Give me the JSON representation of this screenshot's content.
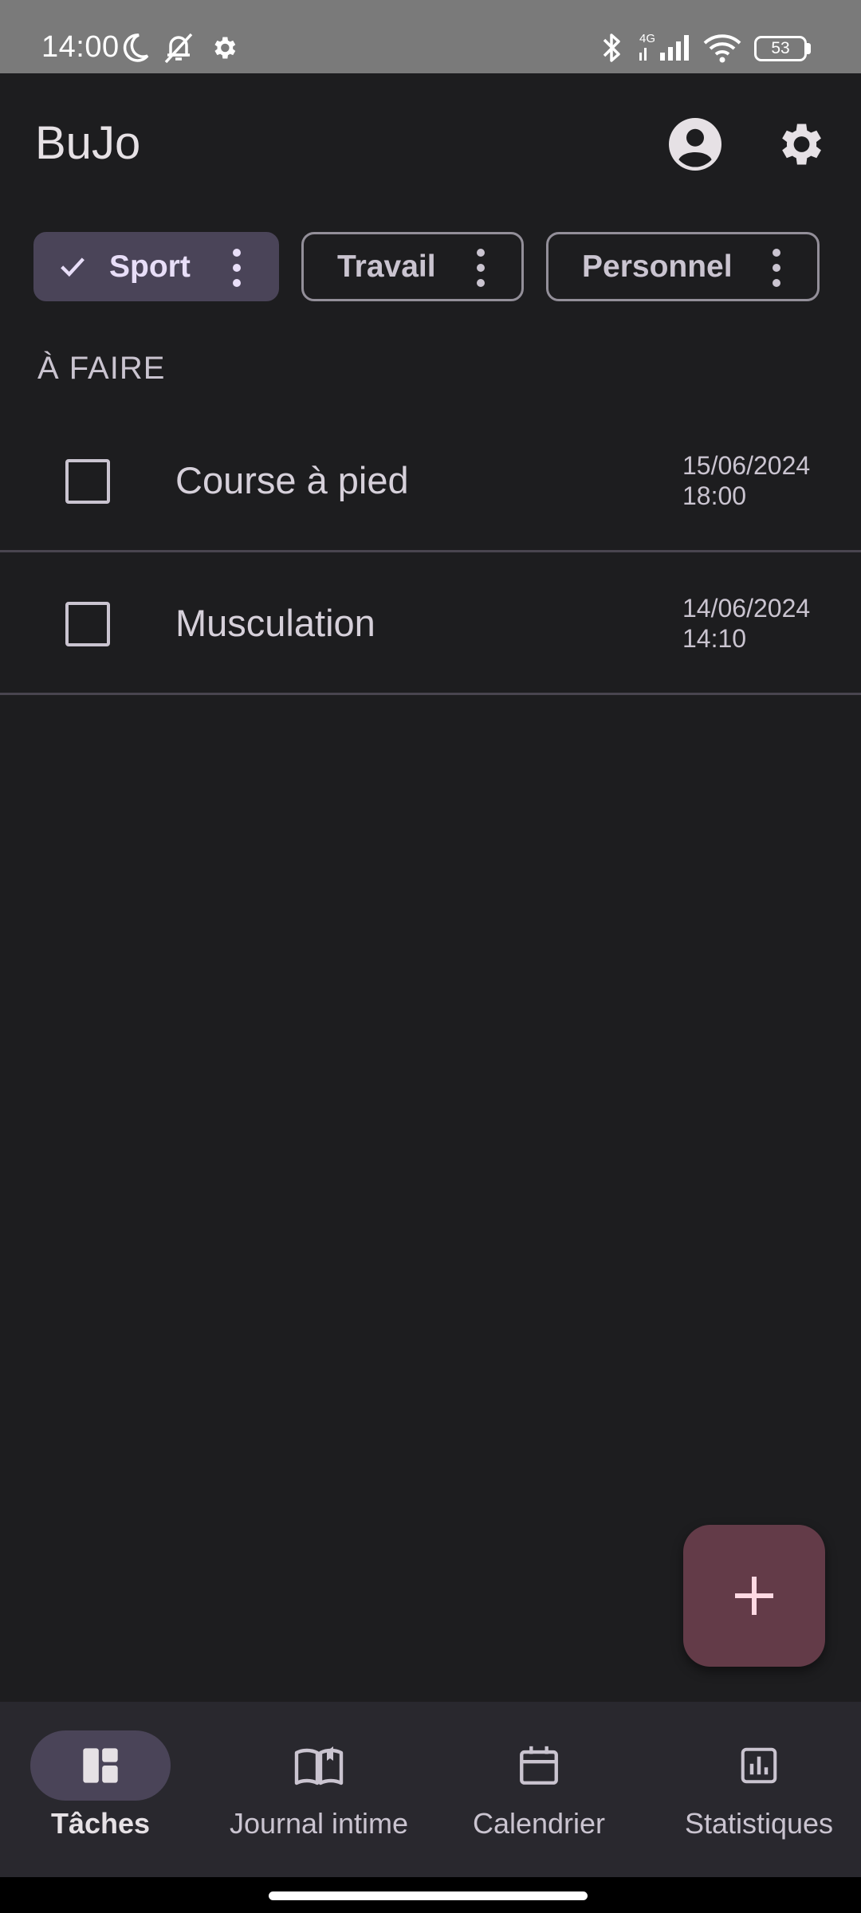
{
  "status_bar": {
    "time": "14:00",
    "network": "4G",
    "battery": "53",
    "icons": [
      "moon-icon",
      "bell-off-icon",
      "gear-icon",
      "bluetooth-icon",
      "signal-icon",
      "wifi-icon",
      "battery-icon"
    ]
  },
  "app_bar": {
    "title": "BuJo",
    "actions": [
      "account-icon",
      "settings-icon"
    ]
  },
  "chips": [
    {
      "label": "Sport",
      "selected": true
    },
    {
      "label": "Travail",
      "selected": false
    },
    {
      "label": "Personnel",
      "selected": false
    }
  ],
  "section": {
    "header": "À FAIRE"
  },
  "tasks": [
    {
      "title": "Course à pied",
      "date": "15/06/2024",
      "time": "18:00",
      "checked": false
    },
    {
      "title": "Musculation",
      "date": "14/06/2024",
      "time": "14:10",
      "checked": false
    }
  ],
  "fab": {
    "icon": "plus-icon"
  },
  "bottom_nav": {
    "items": [
      {
        "label": "Tâches",
        "icon": "dashboard-icon",
        "active": true
      },
      {
        "label": "Journal intime",
        "icon": "book-icon",
        "active": false
      },
      {
        "label": "Calendrier",
        "icon": "calendar-icon",
        "active": false
      },
      {
        "label": "Statistiques",
        "icon": "chart-icon",
        "active": false
      }
    ]
  },
  "colors": {
    "background": "#1d1d1f",
    "chip_selected": "#4a4458",
    "fab": "#633b48",
    "nav_bar": "#29282e",
    "status_bar": "#7a7a7a"
  }
}
